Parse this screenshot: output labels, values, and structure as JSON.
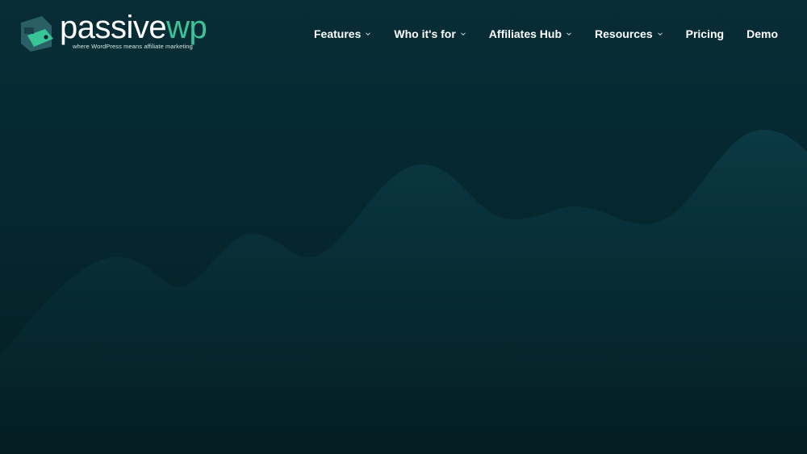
{
  "brand": {
    "name_part1": "passive",
    "name_part2": "wp",
    "tagline": "where WordPress means affiliate marketing",
    "accent_color": "#38c597"
  },
  "nav": {
    "items": [
      {
        "label": "Features",
        "has_dropdown": true
      },
      {
        "label": "Who it's for",
        "has_dropdown": true
      },
      {
        "label": "Affiliates Hub",
        "has_dropdown": true
      },
      {
        "label": "Resources",
        "has_dropdown": true
      },
      {
        "label": "Pricing",
        "has_dropdown": false
      },
      {
        "label": "Demo",
        "has_dropdown": false
      }
    ],
    "dropdown_icon": "chevron-down-icon"
  },
  "colors": {
    "background": "#05262d",
    "wave_fill": "#0a3540"
  }
}
